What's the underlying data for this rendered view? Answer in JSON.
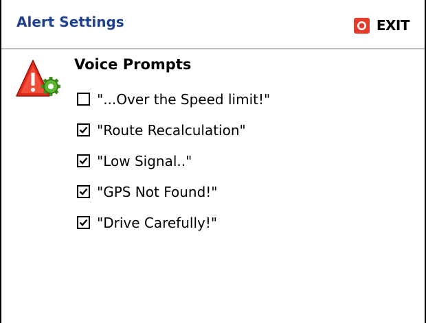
{
  "header": {
    "title": "Alert Settings",
    "exit_label": "EXIT"
  },
  "section": {
    "title": "Voice Prompts",
    "app_icon": "warning-gear-icon"
  },
  "options": [
    {
      "label": "\"...Over the Speed limit!\"",
      "checked": false
    },
    {
      "label": "\"Route Recalculation\"",
      "checked": true
    },
    {
      "label": "\"Low Signal..\"",
      "checked": true
    },
    {
      "label": "\"GPS Not Found!\"",
      "checked": true
    },
    {
      "label": "\"Drive Carefully!\"",
      "checked": true
    }
  ],
  "colors": {
    "title": "#1f3f8f",
    "exit_icon": "#e83b2a",
    "warning": "#e02a1c",
    "gear": "#3e8f1f"
  }
}
